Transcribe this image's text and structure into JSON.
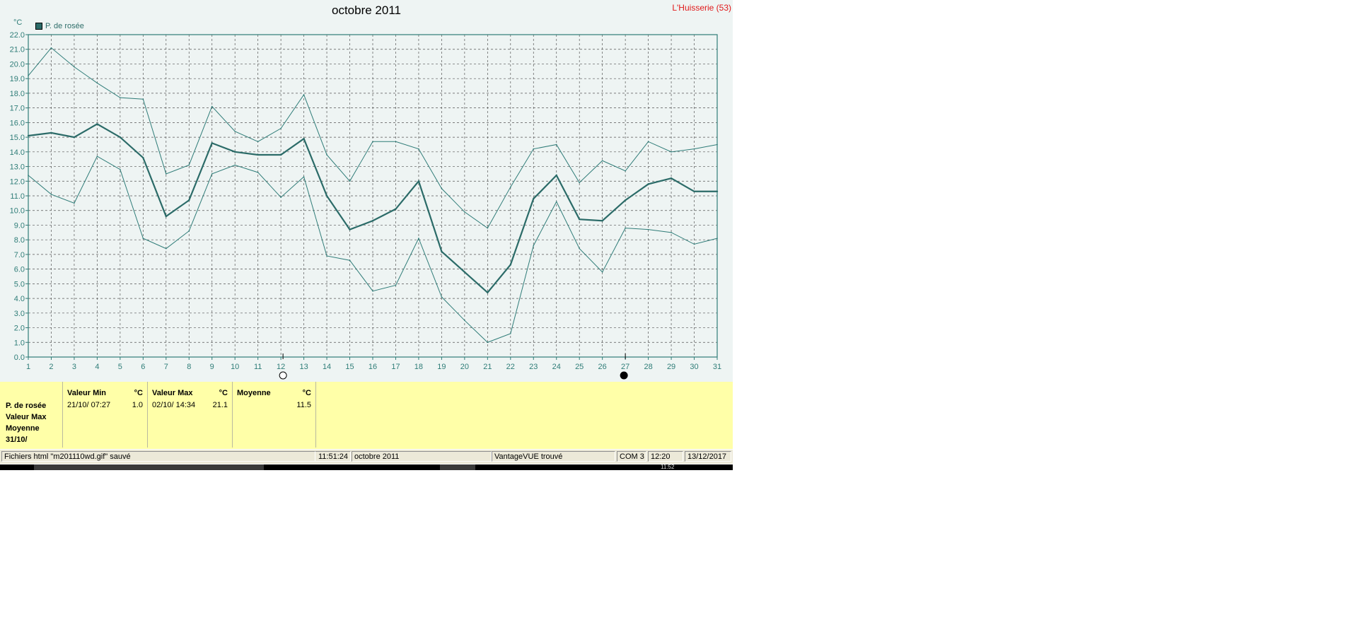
{
  "chart": {
    "title": "octobre 2011",
    "station": "L'Huisserie (53)",
    "unit": "°C",
    "legend": "P. de rosée"
  },
  "chart_data": {
    "type": "line",
    "title": "octobre 2011",
    "ylabel": "°C",
    "xlabel": "",
    "ylim": [
      0,
      22
    ],
    "xlim": [
      1,
      31
    ],
    "grid": true,
    "legend_position": "top-left",
    "categories": [
      1,
      2,
      3,
      4,
      5,
      6,
      7,
      8,
      9,
      10,
      11,
      12,
      13,
      14,
      15,
      16,
      17,
      18,
      19,
      20,
      21,
      22,
      23,
      24,
      25,
      26,
      27,
      28,
      29,
      30,
      31
    ],
    "yticks": [
      "0.0",
      "1.0",
      "2.0",
      "3.0",
      "4.0",
      "5.0",
      "6.0",
      "7.0",
      "8.0",
      "9.0",
      "10.0",
      "11.0",
      "12.0",
      "13.0",
      "14.0",
      "15.0",
      "16.0",
      "17.0",
      "18.0",
      "19.0",
      "20.0",
      "21.0",
      "22.0"
    ],
    "series": [
      {
        "role": "max",
        "color": "#2f7c78",
        "values": [
          19.2,
          21.1,
          19.8,
          18.7,
          17.7,
          17.6,
          12.5,
          13.1,
          17.1,
          15.4,
          14.7,
          15.6,
          17.9,
          13.8,
          12.0,
          14.7,
          14.7,
          14.2,
          11.5,
          9.9,
          8.8,
          11.6,
          14.2,
          14.5,
          11.9,
          13.4,
          12.7,
          14.7,
          14.0,
          14.2,
          14.5
        ]
      },
      {
        "name": "P. de rosée",
        "role": "avg",
        "color": "#2b6b68",
        "values": [
          15.1,
          15.3,
          15.0,
          15.9,
          15.0,
          13.6,
          9.6,
          10.7,
          14.6,
          14.0,
          13.8,
          13.8,
          14.9,
          11.0,
          8.7,
          9.3,
          10.1,
          12.0,
          7.2,
          5.8,
          4.4,
          6.3,
          10.8,
          12.4,
          9.4,
          9.3,
          10.7,
          11.8,
          12.2,
          11.3,
          11.3
        ]
      },
      {
        "role": "min",
        "color": "#2f7c78",
        "values": [
          12.4,
          11.1,
          10.5,
          13.7,
          12.8,
          8.1,
          7.4,
          8.6,
          12.5,
          13.1,
          12.6,
          10.9,
          12.3,
          6.9,
          6.6,
          4.5,
          4.9,
          8.1,
          4.1,
          2.5,
          1.0,
          1.6,
          7.6,
          10.6,
          7.4,
          5.8,
          8.8,
          8.7,
          8.5,
          7.7,
          8.1
        ]
      }
    ]
  },
  "stats": {
    "row_labels": [
      "P. de rosée",
      "Valeur Max",
      "Moyenne",
      "31/10/"
    ],
    "min": {
      "header": "Valeur Min",
      "unit": "°C",
      "time": "21/10/  07:27",
      "value": "1.0"
    },
    "max": {
      "header": "Valeur Max",
      "unit": "°C",
      "time": "02/10/  14:34",
      "value": "21.1"
    },
    "avg": {
      "header": "Moyenne",
      "unit": "°C",
      "value": "11.5"
    }
  },
  "status_bar": {
    "message": "Fichiers html  \"m201110wd.gif\"  sauvé",
    "time": "11:51:24",
    "period": "octobre 2011",
    "device": "VantageVUE trouvé",
    "port": "COM 3",
    "clock": "12:20",
    "date": "13/12/2017"
  },
  "taskbar": {
    "clock": "11:52"
  }
}
